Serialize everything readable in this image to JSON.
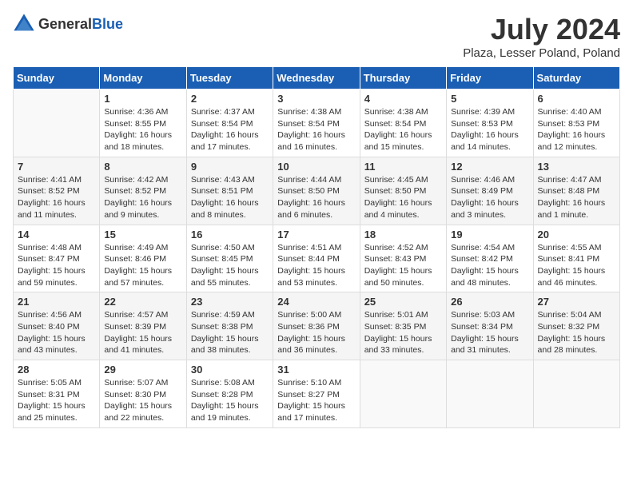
{
  "header": {
    "logo_general": "General",
    "logo_blue": "Blue",
    "month_title": "July 2024",
    "location": "Plaza, Lesser Poland, Poland"
  },
  "days_of_week": [
    "Sunday",
    "Monday",
    "Tuesday",
    "Wednesday",
    "Thursday",
    "Friday",
    "Saturday"
  ],
  "weeks": [
    [
      {
        "day": "",
        "info": ""
      },
      {
        "day": "1",
        "info": "Sunrise: 4:36 AM\nSunset: 8:55 PM\nDaylight: 16 hours\nand 18 minutes."
      },
      {
        "day": "2",
        "info": "Sunrise: 4:37 AM\nSunset: 8:54 PM\nDaylight: 16 hours\nand 17 minutes."
      },
      {
        "day": "3",
        "info": "Sunrise: 4:38 AM\nSunset: 8:54 PM\nDaylight: 16 hours\nand 16 minutes."
      },
      {
        "day": "4",
        "info": "Sunrise: 4:38 AM\nSunset: 8:54 PM\nDaylight: 16 hours\nand 15 minutes."
      },
      {
        "day": "5",
        "info": "Sunrise: 4:39 AM\nSunset: 8:53 PM\nDaylight: 16 hours\nand 14 minutes."
      },
      {
        "day": "6",
        "info": "Sunrise: 4:40 AM\nSunset: 8:53 PM\nDaylight: 16 hours\nand 12 minutes."
      }
    ],
    [
      {
        "day": "7",
        "info": "Sunrise: 4:41 AM\nSunset: 8:52 PM\nDaylight: 16 hours\nand 11 minutes."
      },
      {
        "day": "8",
        "info": "Sunrise: 4:42 AM\nSunset: 8:52 PM\nDaylight: 16 hours\nand 9 minutes."
      },
      {
        "day": "9",
        "info": "Sunrise: 4:43 AM\nSunset: 8:51 PM\nDaylight: 16 hours\nand 8 minutes."
      },
      {
        "day": "10",
        "info": "Sunrise: 4:44 AM\nSunset: 8:50 PM\nDaylight: 16 hours\nand 6 minutes."
      },
      {
        "day": "11",
        "info": "Sunrise: 4:45 AM\nSunset: 8:50 PM\nDaylight: 16 hours\nand 4 minutes."
      },
      {
        "day": "12",
        "info": "Sunrise: 4:46 AM\nSunset: 8:49 PM\nDaylight: 16 hours\nand 3 minutes."
      },
      {
        "day": "13",
        "info": "Sunrise: 4:47 AM\nSunset: 8:48 PM\nDaylight: 16 hours\nand 1 minute."
      }
    ],
    [
      {
        "day": "14",
        "info": "Sunrise: 4:48 AM\nSunset: 8:47 PM\nDaylight: 15 hours\nand 59 minutes."
      },
      {
        "day": "15",
        "info": "Sunrise: 4:49 AM\nSunset: 8:46 PM\nDaylight: 15 hours\nand 57 minutes."
      },
      {
        "day": "16",
        "info": "Sunrise: 4:50 AM\nSunset: 8:45 PM\nDaylight: 15 hours\nand 55 minutes."
      },
      {
        "day": "17",
        "info": "Sunrise: 4:51 AM\nSunset: 8:44 PM\nDaylight: 15 hours\nand 53 minutes."
      },
      {
        "day": "18",
        "info": "Sunrise: 4:52 AM\nSunset: 8:43 PM\nDaylight: 15 hours\nand 50 minutes."
      },
      {
        "day": "19",
        "info": "Sunrise: 4:54 AM\nSunset: 8:42 PM\nDaylight: 15 hours\nand 48 minutes."
      },
      {
        "day": "20",
        "info": "Sunrise: 4:55 AM\nSunset: 8:41 PM\nDaylight: 15 hours\nand 46 minutes."
      }
    ],
    [
      {
        "day": "21",
        "info": "Sunrise: 4:56 AM\nSunset: 8:40 PM\nDaylight: 15 hours\nand 43 minutes."
      },
      {
        "day": "22",
        "info": "Sunrise: 4:57 AM\nSunset: 8:39 PM\nDaylight: 15 hours\nand 41 minutes."
      },
      {
        "day": "23",
        "info": "Sunrise: 4:59 AM\nSunset: 8:38 PM\nDaylight: 15 hours\nand 38 minutes."
      },
      {
        "day": "24",
        "info": "Sunrise: 5:00 AM\nSunset: 8:36 PM\nDaylight: 15 hours\nand 36 minutes."
      },
      {
        "day": "25",
        "info": "Sunrise: 5:01 AM\nSunset: 8:35 PM\nDaylight: 15 hours\nand 33 minutes."
      },
      {
        "day": "26",
        "info": "Sunrise: 5:03 AM\nSunset: 8:34 PM\nDaylight: 15 hours\nand 31 minutes."
      },
      {
        "day": "27",
        "info": "Sunrise: 5:04 AM\nSunset: 8:32 PM\nDaylight: 15 hours\nand 28 minutes."
      }
    ],
    [
      {
        "day": "28",
        "info": "Sunrise: 5:05 AM\nSunset: 8:31 PM\nDaylight: 15 hours\nand 25 minutes."
      },
      {
        "day": "29",
        "info": "Sunrise: 5:07 AM\nSunset: 8:30 PM\nDaylight: 15 hours\nand 22 minutes."
      },
      {
        "day": "30",
        "info": "Sunrise: 5:08 AM\nSunset: 8:28 PM\nDaylight: 15 hours\nand 19 minutes."
      },
      {
        "day": "31",
        "info": "Sunrise: 5:10 AM\nSunset: 8:27 PM\nDaylight: 15 hours\nand 17 minutes."
      },
      {
        "day": "",
        "info": ""
      },
      {
        "day": "",
        "info": ""
      },
      {
        "day": "",
        "info": ""
      }
    ]
  ]
}
